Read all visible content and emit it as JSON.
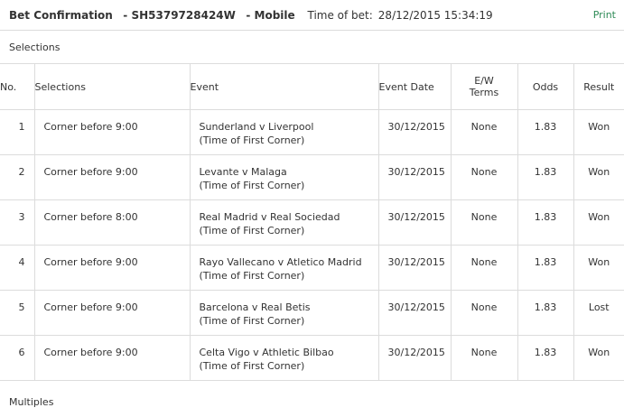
{
  "header": {
    "title": "Bet Confirmation",
    "ref_prefix": "- ",
    "reference": "SH5379728424W",
    "channel_prefix": "- ",
    "channel": "Mobile",
    "time_label": "Time of bet:",
    "time_value": "28/12/2015 15:34:19",
    "print_label": "Print"
  },
  "selections_label": "Selections",
  "multiples_label": "Multiples",
  "table": {
    "headers": {
      "no": "No.",
      "selections": "Selections",
      "event": "Event",
      "event_date": "Event Date",
      "ew_terms_line1": "E/W",
      "ew_terms_line2": "Terms",
      "odds": "Odds",
      "result": "Result"
    },
    "rows": [
      {
        "no": "1",
        "selection": "Corner before 9:00",
        "event": "Sunderland v Liverpool",
        "event_sub": "(Time of First Corner)",
        "date": "30/12/2015",
        "ew": "None",
        "odds": "1.83",
        "result": "Won"
      },
      {
        "no": "2",
        "selection": "Corner before 9:00",
        "event": "Levante v Malaga",
        "event_sub": "(Time of First Corner)",
        "date": "30/12/2015",
        "ew": "None",
        "odds": "1.83",
        "result": "Won"
      },
      {
        "no": "3",
        "selection": "Corner before 8:00",
        "event": "Real Madrid v Real Sociedad",
        "event_sub": "(Time of First Corner)",
        "date": "30/12/2015",
        "ew": "None",
        "odds": "1.83",
        "result": "Won"
      },
      {
        "no": "4",
        "selection": "Corner before 9:00",
        "event": "Rayo Vallecano v Atletico Madrid",
        "event_sub": "(Time of First Corner)",
        "date": "30/12/2015",
        "ew": "None",
        "odds": "1.83",
        "result": "Won"
      },
      {
        "no": "5",
        "selection": "Corner before 9:00",
        "event": "Barcelona v Real Betis",
        "event_sub": "(Time of First Corner)",
        "date": "30/12/2015",
        "ew": "None",
        "odds": "1.83",
        "result": "Lost"
      },
      {
        "no": "6",
        "selection": "Corner before 9:00",
        "event": "Celta Vigo v Athletic Bilbao",
        "event_sub": "(Time of First Corner)",
        "date": "30/12/2015",
        "ew": "None",
        "odds": "1.83",
        "result": "Won"
      }
    ]
  },
  "colors": {
    "print_link": "#2e8b57",
    "border": "#dcdcdc",
    "text": "#333333"
  }
}
